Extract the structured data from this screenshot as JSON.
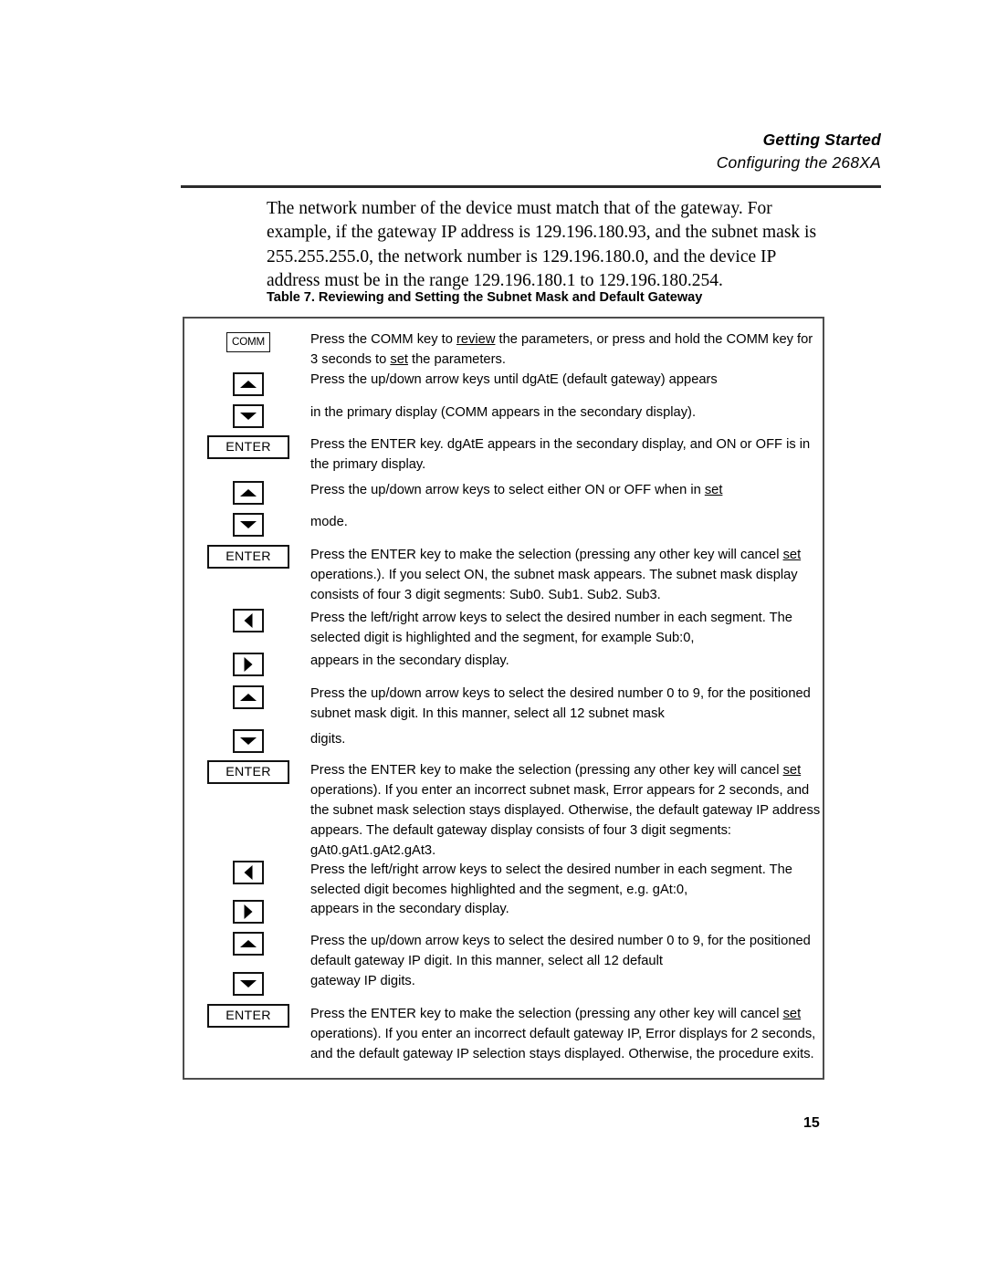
{
  "header": {
    "title": "Getting Started",
    "subtitle": "Configuring the 268XA"
  },
  "intro": {
    "paragraph": "The network number of the device must match that of the gateway. For example, if the gateway IP address is 129.196.180.93, and the subnet mask is 255.255.255.0, the network number is 129.196.180.0, and the device IP address must be in the range 129.196.180.1 to 129.196.180.254."
  },
  "table": {
    "caption": "Table 7. Reviewing and Setting the Subnet Mask and Default Gateway",
    "keys": {
      "comm": "COMM",
      "enter": "ENTER"
    },
    "rows": [
      {
        "key": "COMM",
        "key_type": "comm",
        "text": "Press the COMM key to review the parameters, or press and hold the COMM key for 3 seconds to set the parameters.",
        "underlined": [
          "review",
          "set"
        ]
      },
      {
        "key": "up-arrow",
        "key_type": "arrow-up",
        "text": "Press the up/down arrow keys until dgAtE (default gateway) appears"
      },
      {
        "key": "down-arrow",
        "key_type": "arrow-down",
        "text": "in the primary display (COMM appears in the secondary display)."
      },
      {
        "key": "ENTER",
        "key_type": "enter",
        "text": "Press the ENTER key. dgAtE appears in the secondary display, and ON or OFF is in the primary display."
      },
      {
        "key": "up-arrow",
        "key_type": "arrow-up",
        "text": "Press the up/down arrow keys to select either ON or OFF when in set",
        "underlined": [
          "set"
        ]
      },
      {
        "key": "down-arrow",
        "key_type": "arrow-down",
        "text": "mode."
      },
      {
        "key": "ENTER",
        "key_type": "enter",
        "text": "Press the ENTER key to make the selection (pressing any other key will cancel set operations.). If you select ON, the subnet mask appears. The subnet mask display consists of four 3 digit segments: Sub0. Sub1. Sub2. Sub3.",
        "underlined": [
          "set"
        ]
      },
      {
        "key": "left-arrow",
        "key_type": "arrow-left",
        "text": "Press the left/right arrow keys to select the desired number in each segment. The selected digit is highlighted and the segment, for example Sub:0,"
      },
      {
        "key": "right-arrow",
        "key_type": "arrow-right",
        "text": "appears in the secondary display."
      },
      {
        "key": "up-arrow",
        "key_type": "arrow-up",
        "text": "Press the up/down arrow keys to select the desired number 0 to 9, for the positioned subnet mask digit. In this manner, select all 12 subnet mask"
      },
      {
        "key": "down-arrow",
        "key_type": "arrow-down",
        "text": "digits."
      },
      {
        "key": "ENTER",
        "key_type": "enter",
        "text": "Press the ENTER key to make the selection (pressing any other key will cancel set operations). If you enter an incorrect subnet mask, Error appears for 2 seconds, and the subnet mask selection stays displayed. Otherwise, the default gateway IP address appears. The default gateway display consists of four 3 digit segments: gAt0.gAt1.gAt2.gAt3.",
        "underlined": [
          "set"
        ]
      },
      {
        "key": "left-arrow",
        "key_type": "arrow-left",
        "text": "Press the left/right arrow keys to select the desired number in each segment. The selected digit becomes highlighted and the segment, e.g. gAt:0,"
      },
      {
        "key": "right-arrow",
        "key_type": "arrow-right",
        "text": "appears in the secondary display."
      },
      {
        "key": "up-arrow",
        "key_type": "arrow-up",
        "text": "Press the up/down arrow keys to select the desired number 0 to 9, for the positioned default gateway IP digit. In this manner, select all 12 default"
      },
      {
        "key": "down-arrow",
        "key_type": "arrow-down",
        "text": "gateway IP digits."
      },
      {
        "key": "ENTER",
        "key_type": "enter",
        "text": "Press the ENTER key to make the selection (pressing any other key will cancel set operations). If you enter an incorrect default gateway IP, Error displays for 2 seconds, and the default gateway IP selection stays displayed. Otherwise, the procedure exits.",
        "underlined": [
          "set"
        ]
      }
    ]
  },
  "footer": {
    "page_number": "15"
  }
}
